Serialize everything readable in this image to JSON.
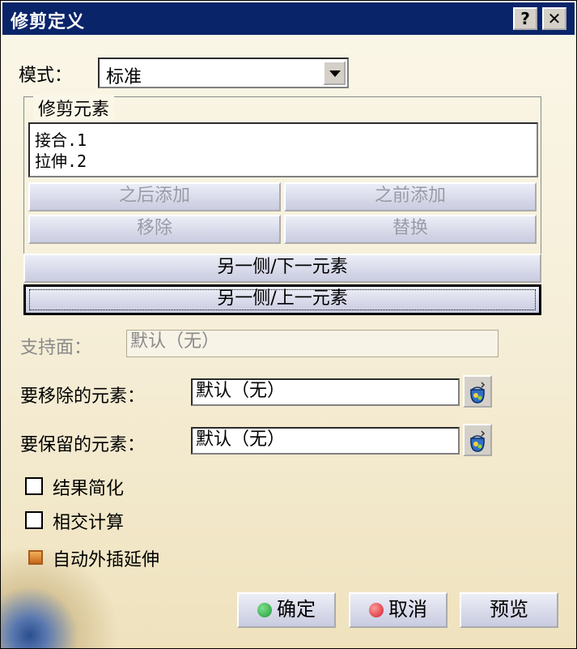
{
  "window": {
    "title": "修剪定义",
    "help_button": "?",
    "close_button": "✕"
  },
  "mode": {
    "label": "模式：",
    "value": "标准"
  },
  "trim_elements": {
    "group_label": "修剪元素",
    "items": [
      "接合.1",
      "拉伸.2"
    ],
    "add_after": "之后添加",
    "add_before": "之前添加",
    "remove": "移除",
    "replace": "替换"
  },
  "other_side_next": "另一侧/下一元素",
  "other_side_previous": "另一侧/上一元素",
  "support": {
    "label": "支持面：",
    "value": "默认（无）"
  },
  "elements_to_remove": {
    "label": "要移除的元素：",
    "value": "默认（无）"
  },
  "elements_to_keep": {
    "label": "要保留的元素：",
    "value": "默认（无）"
  },
  "options": {
    "simplify_result": {
      "label": "结果简化",
      "checked": false
    },
    "intersection_compute": {
      "label": "相交计算",
      "checked": false
    },
    "auto_extrapolation": {
      "label": "自动外插延伸",
      "checked": true
    }
  },
  "footer": {
    "ok": "确定",
    "cancel": "取消",
    "preview": "预览"
  },
  "colors": {
    "title_bar": "#0a246a",
    "ok_dot": "#1f9a3a",
    "cancel_dot": "#d0202a",
    "checked_box": "#e08a3a"
  }
}
